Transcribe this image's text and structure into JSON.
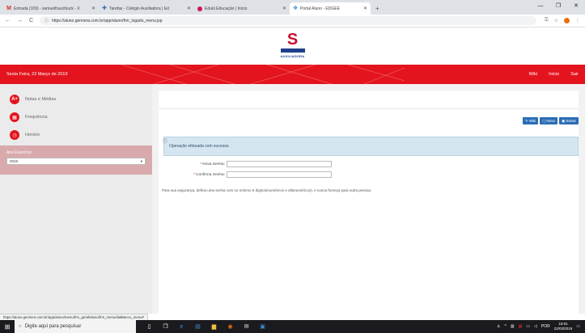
{
  "browser": {
    "tabs": [
      {
        "label": "Entrada (109) - samuelfrauchiuck - X",
        "icon": "gmail-icon",
        "color": "#d93025",
        "active": false
      },
      {
        "label": "Tarefas - Colégio Auxiliadora | Ed",
        "icon": "tarefas-icon",
        "color": "#3a66b0",
        "active": false
      },
      {
        "label": "Edulú Educação | Início",
        "icon": "edulu-icon",
        "color": "#d4145a",
        "active": false
      },
      {
        "label": "Portal Aluno - EDGEE",
        "icon": "portal-icon",
        "color": "#3a8fd8",
        "active": true
      }
    ],
    "new_tab": "+",
    "url": "https://aluno.gennera.com.br/app/aluno/frm_logado_menu.jsp",
    "status_url": "https://aluno.gennera.com.br/app/aluno/menu/frm_geral/aluno/frm_menu/dialBanco_menu#"
  },
  "logo": {
    "name": "AUXILIADORA"
  },
  "header": {
    "date": "Sexta Feira, 22 Março de 2019",
    "links": [
      "Wiki",
      "Início",
      "Sair"
    ],
    "color": "#e3141e"
  },
  "sidebar": {
    "items": [
      {
        "label": "Notas e Médias",
        "icon": "grades-icon",
        "glyph": "A+"
      },
      {
        "label": "Frequência",
        "icon": "calendar-icon",
        "glyph": "▦"
      },
      {
        "label": "Horário",
        "icon": "clock-icon",
        "glyph": "◷"
      }
    ],
    "year_title": "Ano Exercício",
    "year_value": "2019"
  },
  "toolbar": {
    "wiki": "Wiki",
    "novo": "Novo",
    "salvar": "Salvar"
  },
  "alert": {
    "message": "Operação efetuada com sucesso."
  },
  "form": {
    "new_password_label": "Nova Senha:",
    "confirm_password_label": "Confirma Senha:",
    "new_password_value": "",
    "confirm_password_value": ""
  },
  "hint": "Para sua segurança, defina uma senha com no mínimo 6 dígitos(numéricos e alfanuméricos), e nunca forneça para outra pessoa.",
  "taskbar": {
    "search_placeholder": "Digite aqui para pesquisar",
    "lang": "POR",
    "time": "15:51",
    "date": "22/03/2019"
  }
}
